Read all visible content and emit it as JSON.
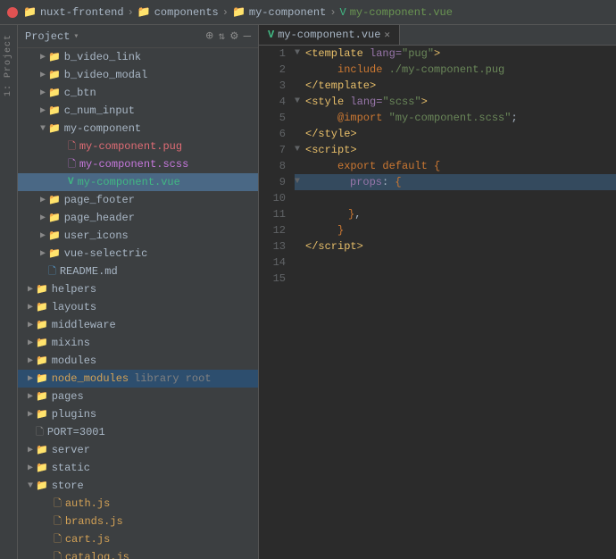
{
  "titlebar": {
    "breadcrumbs": [
      "nuxt-frontend",
      "components",
      "my-component",
      "my-component.vue"
    ]
  },
  "sidebar": {
    "label": "1: Project"
  },
  "filetree": {
    "title": "Project",
    "items": [
      {
        "id": "b_video_link",
        "level": 1,
        "type": "folder",
        "label": "b_video_link",
        "expanded": false
      },
      {
        "id": "b_video_modal",
        "level": 1,
        "type": "folder",
        "label": "b_video_modal",
        "expanded": false
      },
      {
        "id": "c_btn",
        "level": 1,
        "type": "folder",
        "label": "c_btn",
        "expanded": false
      },
      {
        "id": "c_num_input",
        "level": 1,
        "type": "folder",
        "label": "c_num_input",
        "expanded": false
      },
      {
        "id": "my-component",
        "level": 1,
        "type": "folder",
        "label": "my-component",
        "expanded": true
      },
      {
        "id": "my-component.pug",
        "level": 2,
        "type": "pug",
        "label": "my-component.pug"
      },
      {
        "id": "my-component.scss",
        "level": 2,
        "type": "scss",
        "label": "my-component.scss"
      },
      {
        "id": "my-component.vue",
        "level": 2,
        "type": "vue",
        "label": "my-component.vue",
        "selected": true
      },
      {
        "id": "page_footer",
        "level": 1,
        "type": "folder",
        "label": "page_footer",
        "expanded": false
      },
      {
        "id": "page_header",
        "level": 1,
        "type": "folder",
        "label": "page_header",
        "expanded": false
      },
      {
        "id": "user_icons",
        "level": 1,
        "type": "folder",
        "label": "user_icons",
        "expanded": false
      },
      {
        "id": "vue-selectric",
        "level": 1,
        "type": "folder",
        "label": "vue-selectric",
        "expanded": false
      },
      {
        "id": "README.md",
        "level": 1,
        "type": "readme",
        "label": "README.md"
      },
      {
        "id": "helpers",
        "level": 0,
        "type": "folder",
        "label": "helpers",
        "expanded": false
      },
      {
        "id": "layouts",
        "level": 0,
        "type": "folder",
        "label": "layouts",
        "expanded": false
      },
      {
        "id": "middleware",
        "level": 0,
        "type": "folder",
        "label": "middleware",
        "expanded": false
      },
      {
        "id": "mixins",
        "level": 0,
        "type": "folder",
        "label": "mixins",
        "expanded": false
      },
      {
        "id": "modules",
        "level": 0,
        "type": "folder",
        "label": "modules",
        "expanded": false
      },
      {
        "id": "node_modules",
        "level": 0,
        "type": "folder",
        "label": "node_modules",
        "sublabel": "library root",
        "highlighted": true
      },
      {
        "id": "pages",
        "level": 0,
        "type": "folder",
        "label": "pages",
        "expanded": false
      },
      {
        "id": "plugins",
        "level": 0,
        "type": "folder",
        "label": "plugins",
        "expanded": false
      },
      {
        "id": "PORT=3001",
        "level": 0,
        "type": "generic",
        "label": "PORT=3001"
      },
      {
        "id": "server",
        "level": 0,
        "type": "folder",
        "label": "server",
        "expanded": false
      },
      {
        "id": "static",
        "level": 0,
        "type": "folder",
        "label": "static",
        "expanded": false
      },
      {
        "id": "store",
        "level": 0,
        "type": "folder",
        "label": "store",
        "expanded": true
      },
      {
        "id": "auth.js",
        "level": 1,
        "type": "js",
        "label": "auth.js"
      },
      {
        "id": "brands.js",
        "level": 1,
        "type": "js",
        "label": "brands.js"
      },
      {
        "id": "cart.js",
        "level": 1,
        "type": "js",
        "label": "cart.js"
      },
      {
        "id": "catalog.js",
        "level": 1,
        "type": "js",
        "label": "catalog.js"
      }
    ]
  },
  "editor": {
    "tab": "my-component.vue",
    "lines": [
      {
        "num": 1,
        "fold": true,
        "content": "<template lang=\"pug\">"
      },
      {
        "num": 2,
        "fold": false,
        "indent": "    ",
        "content": "include ./my-component.pug"
      },
      {
        "num": 3,
        "fold": false,
        "content": "</template>"
      },
      {
        "num": 4,
        "fold": true,
        "content": "<style lang=\"scss\">"
      },
      {
        "num": 5,
        "fold": false,
        "indent": "    ",
        "content": "@import \"my-component.scss\";"
      },
      {
        "num": 6,
        "fold": false,
        "content": "</style>"
      },
      {
        "num": 7,
        "fold": true,
        "content": "<script>"
      },
      {
        "num": 8,
        "fold": false,
        "indent": "    ",
        "content": "export default {"
      },
      {
        "num": 9,
        "fold": false,
        "indent": "        ",
        "content": "props: {",
        "highlighted": true
      },
      {
        "num": 10,
        "fold": false,
        "content": ""
      },
      {
        "num": 11,
        "fold": false,
        "indent": "        ",
        "content": "},"
      },
      {
        "num": 12,
        "fold": false,
        "indent": "    ",
        "content": "}"
      },
      {
        "num": 13,
        "fold": false,
        "content": "<\\/script>"
      },
      {
        "num": 14,
        "fold": false,
        "content": ""
      },
      {
        "num": 15,
        "fold": false,
        "content": ""
      }
    ]
  }
}
